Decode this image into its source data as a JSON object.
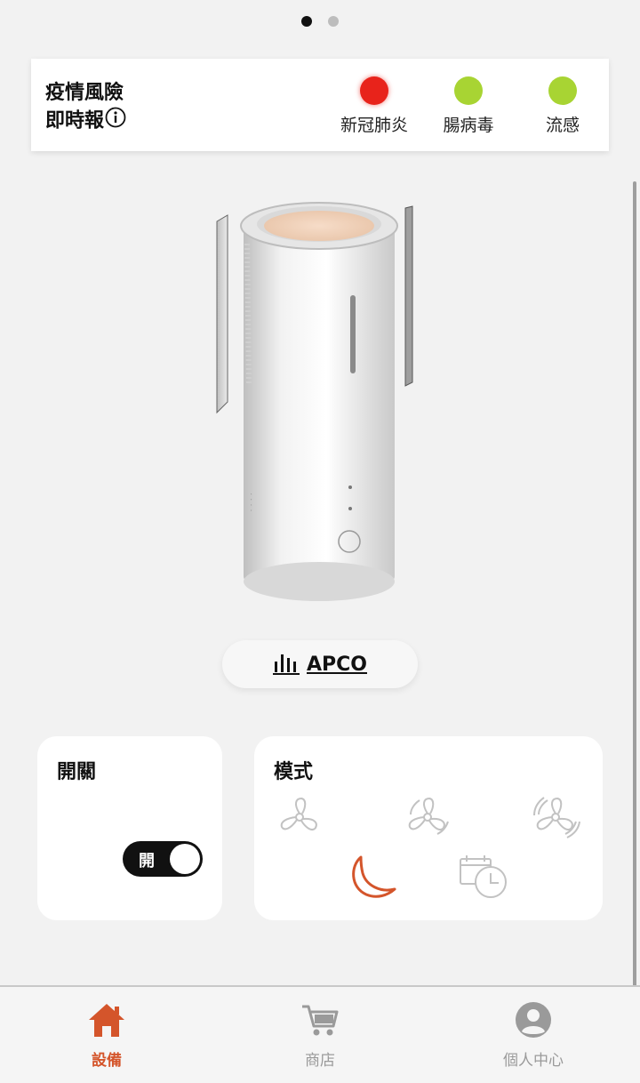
{
  "pager": {
    "count": 2,
    "active": 0
  },
  "risk": {
    "title_line1": "疫情風險",
    "title_line2": "即時報",
    "items": [
      {
        "label": "新冠肺炎",
        "color": "#e8231b"
      },
      {
        "label": "腸病毒",
        "color": "#a8d433"
      },
      {
        "label": "流感",
        "color": "#a8d433"
      }
    ]
  },
  "device": {
    "name": "APCO"
  },
  "power": {
    "title": "開關",
    "toggle_label": "開",
    "on": true
  },
  "mode": {
    "title": "模式",
    "options": [
      "fan-low-icon",
      "fan-medium-icon",
      "fan-high-icon",
      "sleep-moon-icon",
      "schedule-timer-icon"
    ],
    "selected": "sleep-moon-icon",
    "accent": "#d4552b"
  },
  "nav": {
    "items": [
      {
        "label": "設備",
        "icon": "home-icon",
        "active": true
      },
      {
        "label": "商店",
        "icon": "cart-icon",
        "active": false
      },
      {
        "label": "個人中心",
        "icon": "user-icon",
        "active": false
      }
    ]
  }
}
